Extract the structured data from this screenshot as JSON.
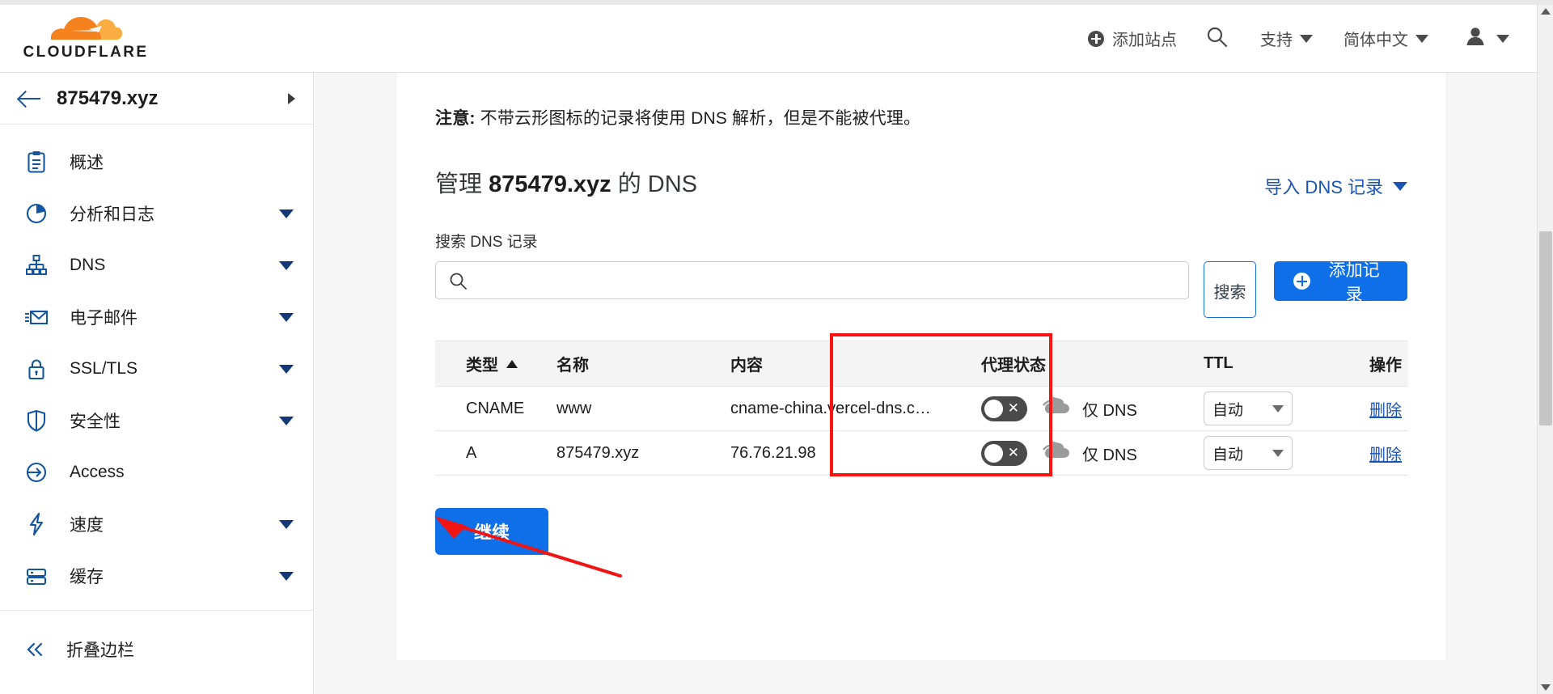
{
  "header": {
    "logo_text": "CLOUDFLARE",
    "add_site_label": "添加站点",
    "search_icon": "search-icon",
    "support_label": "支持",
    "language_label": "简体中文",
    "account_icon": "user-avatar-icon"
  },
  "sidebar": {
    "zone_name": "875479.xyz",
    "back_icon": "arrow-left-icon",
    "items": [
      {
        "label": "概述",
        "icon": "clipboard-icon",
        "expandable": false
      },
      {
        "label": "分析和日志",
        "icon": "pie-chart-icon",
        "expandable": true
      },
      {
        "label": "DNS",
        "icon": "sitemap-icon",
        "expandable": true
      },
      {
        "label": "电子邮件",
        "icon": "envelope-icon",
        "expandable": true
      },
      {
        "label": "SSL/TLS",
        "icon": "lock-icon",
        "expandable": true
      },
      {
        "label": "安全性",
        "icon": "shield-icon",
        "expandable": true
      },
      {
        "label": "Access",
        "icon": "sign-in-icon",
        "expandable": false
      },
      {
        "label": "速度",
        "icon": "lightning-icon",
        "expandable": true
      },
      {
        "label": "缓存",
        "icon": "database-icon",
        "expandable": true
      }
    ],
    "collapse_label": "折叠边栏",
    "collapse_icon": "chevron-double-left-icon"
  },
  "main": {
    "notice_bold": "注意:",
    "notice_text": "不带云形图标的记录将使用 DNS 解析，但是不能被代理。",
    "title_prefix": "管理 ",
    "title_domain": "875479.xyz",
    "title_suffix": " 的 DNS",
    "import_label": "导入 DNS 记录",
    "search_label": "搜索 DNS 记录",
    "search_value": "",
    "search_placeholder": "",
    "search_button_label": "搜索",
    "add_record_label": "添加记录",
    "continue_label": "继续"
  },
  "table": {
    "columns": [
      "类型",
      "名称",
      "内容",
      "代理状态",
      "TTL",
      "操作"
    ],
    "sort_column": "类型",
    "sort_direction": "asc",
    "rows": [
      {
        "type": "CNAME",
        "name": "www",
        "content": "cname-china.vercel-dns.c…",
        "proxy_state": "仅 DNS",
        "proxy_enabled": false,
        "ttl": "自动",
        "action": "删除"
      },
      {
        "type": "A",
        "name": "875479.xyz",
        "content": "76.76.21.98",
        "proxy_state": "仅 DNS",
        "proxy_enabled": false,
        "ttl": "自动",
        "action": "删除"
      }
    ]
  },
  "annotations": {
    "highlight_color": "#fb1414",
    "highlight_target": "代理状态",
    "arrow_target": "继续"
  },
  "colors": {
    "brand_orange": "#f6821f",
    "accent_blue": "#0f6fe8",
    "link_blue": "#1a55b5",
    "sidebar_icon_blue": "#13559e"
  }
}
